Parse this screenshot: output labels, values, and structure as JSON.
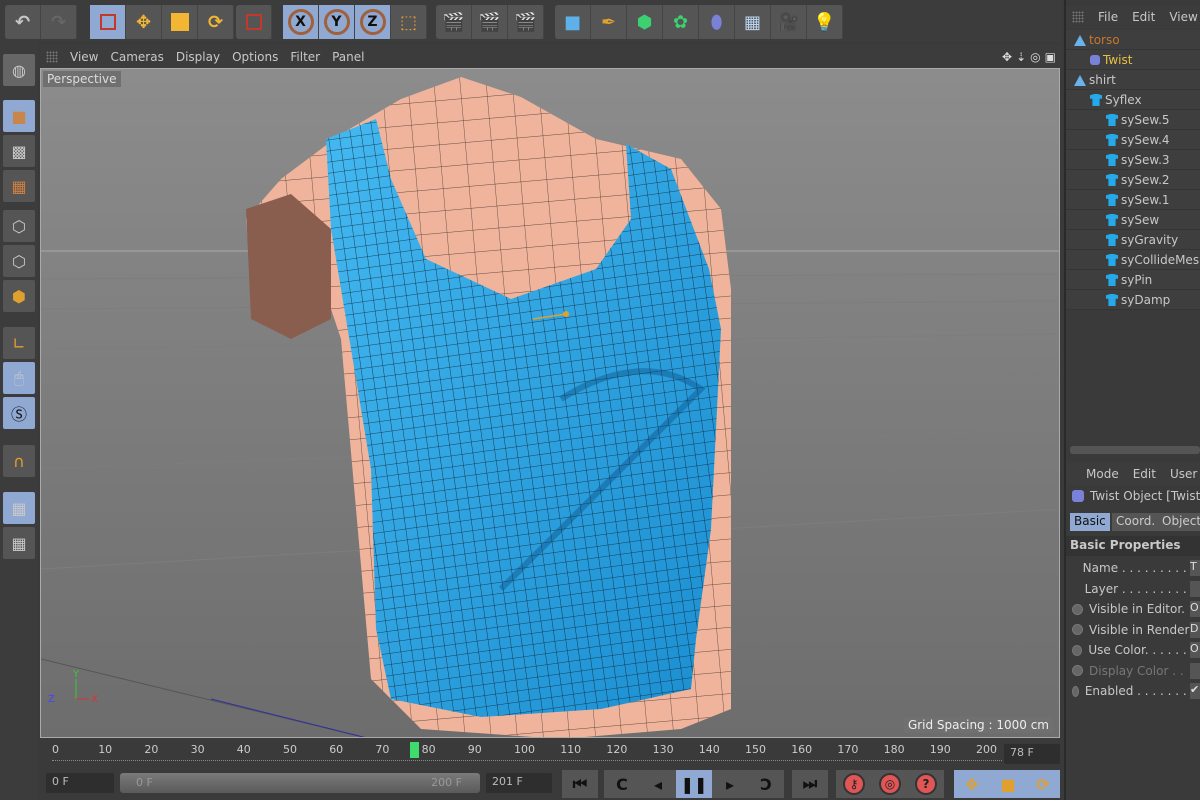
{
  "toolbar": {
    "buttons": [
      "undo-icon",
      "redo-icon",
      "live-selection-icon",
      "move-icon",
      "scale-icon",
      "rotate-icon",
      "selection-mode-icon",
      "x-axis-lock",
      "y-axis-lock",
      "z-axis-lock",
      "world-coordinates-icon",
      "render-view-icon",
      "render-picture-viewer-icon",
      "render-settings-icon",
      "cube-icon",
      "pen-icon",
      "subdivision-icon",
      "cloner-icon",
      "deformer-icon",
      "floor-icon",
      "camera-icon",
      "light-icon"
    ],
    "x": "X",
    "y": "Y",
    "z": "Z"
  },
  "viewport": {
    "menu": [
      "View",
      "Cameras",
      "Display",
      "Options",
      "Filter",
      "Panel"
    ],
    "camera": "Perspective",
    "grid_spacing": "Grid Spacing : 1000 cm",
    "axis_labels": {
      "x": "X",
      "y": "Y",
      "z": "Z"
    }
  },
  "timeline": {
    "ticks": [
      "0",
      "10",
      "20",
      "30",
      "40",
      "50",
      "60",
      "70",
      "80",
      "90",
      "100",
      "110",
      "120",
      "130",
      "140",
      "150",
      "160",
      "170",
      "180",
      "190",
      "200"
    ],
    "current_frame": "78 F",
    "current_value": 78,
    "start": "0 F",
    "range_start": "0 F",
    "range_end": "200 F",
    "end": "201 F"
  },
  "object_manager": {
    "menu": [
      "File",
      "Edit",
      "View"
    ],
    "objects": [
      {
        "name": "torso",
        "level": 0,
        "icon": "null-icon",
        "color": "#c8782a"
      },
      {
        "name": "Twist",
        "level": 1,
        "icon": "twist-icon",
        "color": "#e8c040"
      },
      {
        "name": "shirt",
        "level": 0,
        "icon": "null-icon",
        "color": "#c8c8c8"
      },
      {
        "name": "Syflex",
        "level": 1,
        "icon": "shirt-icon",
        "color": "#c8c8c8"
      },
      {
        "name": "sySew.5",
        "level": 2,
        "icon": "shirt-icon",
        "color": "#c8c8c8"
      },
      {
        "name": "sySew.4",
        "level": 2,
        "icon": "shirt-icon",
        "color": "#c8c8c8"
      },
      {
        "name": "sySew.3",
        "level": 2,
        "icon": "shirt-icon",
        "color": "#c8c8c8"
      },
      {
        "name": "sySew.2",
        "level": 2,
        "icon": "shirt-icon",
        "color": "#c8c8c8"
      },
      {
        "name": "sySew.1",
        "level": 2,
        "icon": "shirt-icon",
        "color": "#c8c8c8"
      },
      {
        "name": "sySew",
        "level": 2,
        "icon": "shirt-icon",
        "color": "#c8c8c8"
      },
      {
        "name": "syGravity",
        "level": 2,
        "icon": "shirt-icon",
        "color": "#c8c8c8"
      },
      {
        "name": "syCollideMesh",
        "level": 2,
        "icon": "shirt-icon",
        "color": "#c8c8c8"
      },
      {
        "name": "syPin",
        "level": 2,
        "icon": "shirt-icon",
        "color": "#c8c8c8"
      },
      {
        "name": "syDamp",
        "level": 2,
        "icon": "shirt-icon",
        "color": "#c8c8c8"
      }
    ]
  },
  "attributes": {
    "menu": [
      "Mode",
      "Edit",
      "User D"
    ],
    "title": "Twist Object [Twist]",
    "tabs": [
      "Basic",
      "Coord.",
      "Object"
    ],
    "section": "Basic Properties",
    "props": [
      {
        "label": "Name . . . . . . . . . . .",
        "value": "T"
      },
      {
        "label": "Layer . . . . . . . . . . .",
        "value": ""
      },
      {
        "label": "Visible in Editor. . .",
        "value": "O"
      },
      {
        "label": "Visible in Renderer",
        "value": "D"
      },
      {
        "label": "Use Color. . . . . . . .",
        "value": "O"
      },
      {
        "label": "Display Color . .",
        "value": ""
      },
      {
        "label": "Enabled . . . . . . . . .",
        "value": "✔"
      }
    ]
  },
  "colors": {
    "accent": "#8fa9d3",
    "shirt": "#26a9e8",
    "skin": "#f0b49c",
    "playhead": "#3ddc6c"
  }
}
